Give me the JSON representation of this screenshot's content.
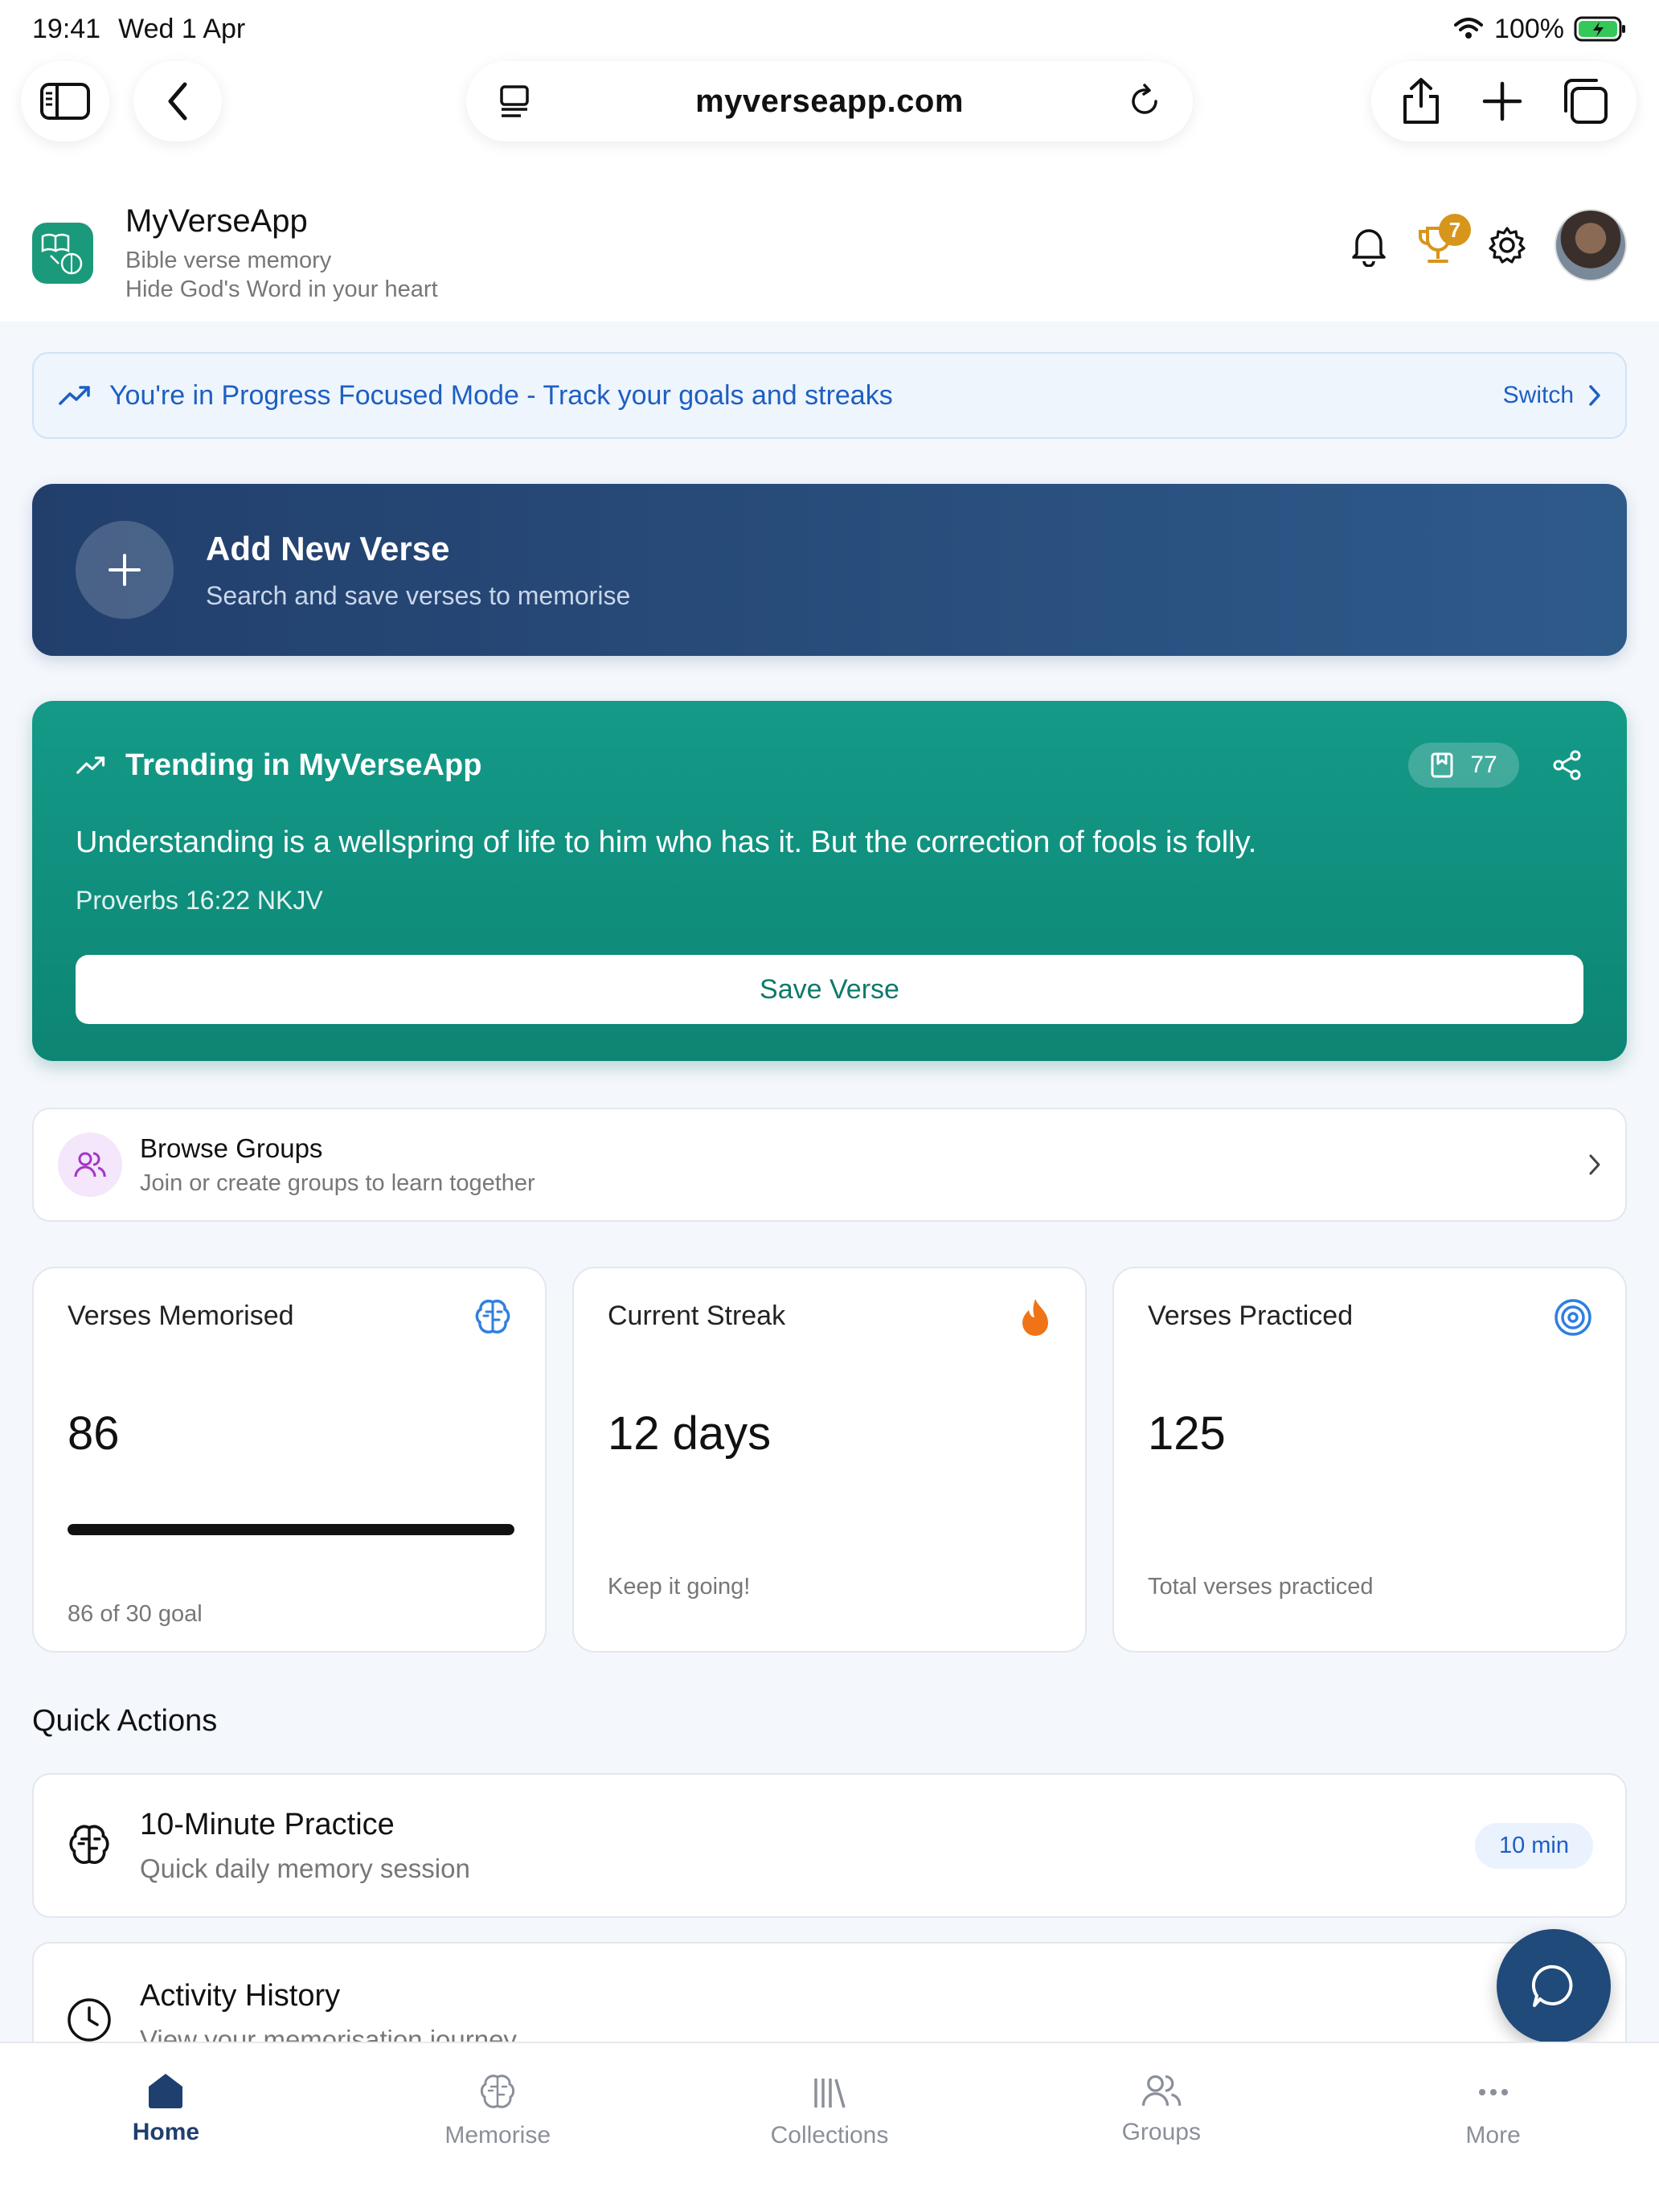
{
  "status_bar": {
    "time": "19:41",
    "date": "Wed 1 Apr",
    "battery": "100%"
  },
  "browser": {
    "url": "myverseapp.com"
  },
  "app": {
    "name": "MyVerseApp",
    "tagline": "Bible verse memory",
    "subtagline": "Hide God's Word in your heart",
    "trophy_badge": "7"
  },
  "mode_banner": {
    "text": "You're in Progress Focused Mode - Track your goals and streaks",
    "switch_label": "Switch"
  },
  "add_verse": {
    "title": "Add New Verse",
    "subtitle": "Search and save verses to memorise"
  },
  "trending": {
    "title": "Trending in MyVerseApp",
    "save_count": "77",
    "verse_text": "Understanding is a wellspring of life to him who has it. But the correction of fools is folly.",
    "reference": "Proverbs 16:22 NKJV",
    "save_label": "Save Verse"
  },
  "groups": {
    "title": "Browse Groups",
    "subtitle": "Join or create groups to learn together"
  },
  "stats": {
    "memorised": {
      "label": "Verses Memorised",
      "value": "86",
      "footer": "86 of 30 goal",
      "progress": 1.0
    },
    "streak": {
      "label": "Current Streak",
      "value": "12 days",
      "footer": "Keep it going!"
    },
    "practiced": {
      "label": "Verses Practiced",
      "value": "125",
      "footer": "Total verses practiced"
    }
  },
  "quick_actions": {
    "heading": "Quick Actions",
    "items": [
      {
        "title": "10-Minute Practice",
        "subtitle": "Quick daily memory session",
        "badge": "10 min"
      },
      {
        "title": "Activity History",
        "subtitle": "View your memorisation journey"
      }
    ]
  },
  "nav": {
    "items": [
      {
        "label": "Home",
        "icon": "home-icon",
        "active": true
      },
      {
        "label": "Memorise",
        "icon": "brain-icon"
      },
      {
        "label": "Collections",
        "icon": "library-icon"
      },
      {
        "label": "Groups",
        "icon": "users-icon"
      },
      {
        "label": "More",
        "icon": "more-icon"
      }
    ]
  },
  "colors": {
    "primary_navy": "#223f6c",
    "trending_teal": "#149a88",
    "accent_blue": "#1d5fc2",
    "streak_orange": "#f07317",
    "trophy_gold": "#d8951b"
  }
}
